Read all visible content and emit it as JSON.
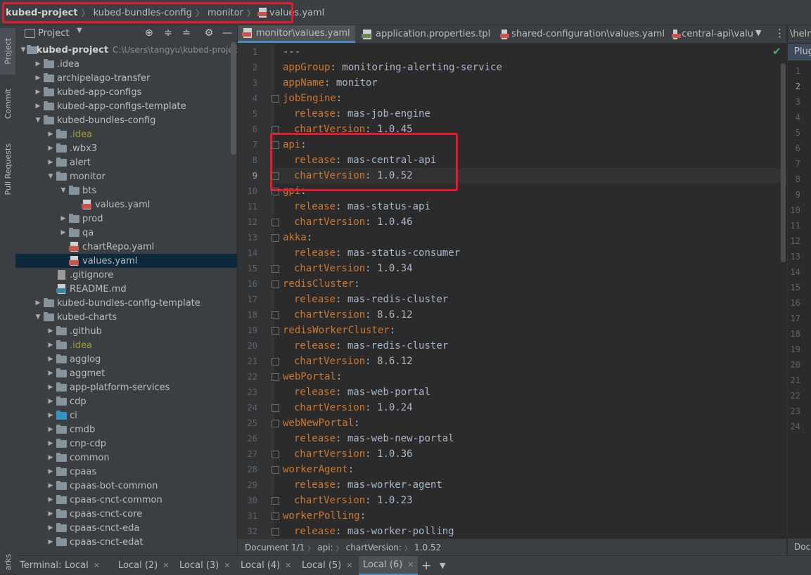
{
  "navbar": {
    "crumbs": [
      "kubed-project",
      "kubed-bundles-config",
      "monitor",
      "values.yaml"
    ]
  },
  "left_stripe": {
    "tabs": [
      "Project",
      "Commit",
      "Pull Requests"
    ],
    "bottom_tab": "arks"
  },
  "project_panel": {
    "title": "Project",
    "tree": [
      {
        "name": "kubed-project",
        "path": "C:\\Users\\tangyu\\kubed-project",
        "depth": 0,
        "type": "folder",
        "expanded": true,
        "bold": true
      },
      {
        "name": ".idea",
        "depth": 1,
        "type": "folder"
      },
      {
        "name": "archipelago-transfer",
        "depth": 1,
        "type": "folder"
      },
      {
        "name": "kubed-app-configs",
        "depth": 1,
        "type": "folder"
      },
      {
        "name": "kubed-app-configs-template",
        "depth": 1,
        "type": "folder"
      },
      {
        "name": "kubed-bundles-config",
        "depth": 1,
        "type": "folder",
        "expanded": true
      },
      {
        "name": ".idea",
        "depth": 2,
        "type": "folder",
        "ignored": true
      },
      {
        "name": ".wbx3",
        "depth": 2,
        "type": "folder"
      },
      {
        "name": "alert",
        "depth": 2,
        "type": "folder"
      },
      {
        "name": "monitor",
        "depth": 2,
        "type": "folder",
        "expanded": true
      },
      {
        "name": "bts",
        "depth": 3,
        "type": "folder",
        "expanded": true
      },
      {
        "name": "values.yaml",
        "depth": 4,
        "type": "yaml"
      },
      {
        "name": "prod",
        "depth": 3,
        "type": "folder"
      },
      {
        "name": "qa",
        "depth": 3,
        "type": "folder"
      },
      {
        "name": "chartRepo.yaml",
        "depth": 3,
        "type": "yaml",
        "leaf": true
      },
      {
        "name": "values.yaml",
        "depth": 3,
        "type": "yaml",
        "leaf": true,
        "selected": true
      },
      {
        "name": ".gitignore",
        "depth": 2,
        "type": "file",
        "leaf": true
      },
      {
        "name": "README.md",
        "depth": 2,
        "type": "md",
        "leaf": true
      },
      {
        "name": "kubed-bundles-config-template",
        "depth": 1,
        "type": "folder"
      },
      {
        "name": "kubed-charts",
        "depth": 1,
        "type": "folder",
        "expanded": true
      },
      {
        "name": ".github",
        "depth": 2,
        "type": "folder"
      },
      {
        "name": ".idea",
        "depth": 2,
        "type": "folder",
        "ignored": true
      },
      {
        "name": "agglog",
        "depth": 2,
        "type": "folder"
      },
      {
        "name": "aggmet",
        "depth": 2,
        "type": "folder"
      },
      {
        "name": "app-platform-services",
        "depth": 2,
        "type": "folder"
      },
      {
        "name": "cdp",
        "depth": 2,
        "type": "folder"
      },
      {
        "name": "ci",
        "depth": 2,
        "type": "folder",
        "blue": true
      },
      {
        "name": "cmdb",
        "depth": 2,
        "type": "folder"
      },
      {
        "name": "cnp-cdp",
        "depth": 2,
        "type": "folder"
      },
      {
        "name": "common",
        "depth": 2,
        "type": "folder"
      },
      {
        "name": "cpaas",
        "depth": 2,
        "type": "folder"
      },
      {
        "name": "cpaas-bot-common",
        "depth": 2,
        "type": "folder"
      },
      {
        "name": "cpaas-cnct-common",
        "depth": 2,
        "type": "folder"
      },
      {
        "name": "cpaas-cnct-core",
        "depth": 2,
        "type": "folder"
      },
      {
        "name": "cpaas-cnct-eda",
        "depth": 2,
        "type": "folder"
      },
      {
        "name": "cpaas-cnct-edat",
        "depth": 2,
        "type": "folder"
      }
    ]
  },
  "editor_tabs": [
    {
      "label": "monitor\\values.yaml",
      "icon": "yaml",
      "active": true
    },
    {
      "label": "application.properties.tpl",
      "icon": "doc"
    },
    {
      "label": "shared-configuration\\values.yaml",
      "icon": "yaml"
    },
    {
      "label": "central-api\\valu",
      "icon": "yaml"
    }
  ],
  "editor": {
    "current_line": 9,
    "lines": [
      {
        "n": 1,
        "indent": 0,
        "key": "---",
        "value": ""
      },
      {
        "n": 2,
        "indent": 0,
        "key": "appGroup",
        "value": "monitoring-alerting-service"
      },
      {
        "n": 3,
        "indent": 0,
        "key": "appName",
        "value": "monitor"
      },
      {
        "n": 4,
        "indent": 0,
        "key": "jobEngine",
        "value": ""
      },
      {
        "n": 5,
        "indent": 1,
        "key": "release",
        "value": "mas-job-engine"
      },
      {
        "n": 6,
        "indent": 1,
        "key": "chartVersion",
        "value": "1.0.45"
      },
      {
        "n": 7,
        "indent": 0,
        "key": "api",
        "value": ""
      },
      {
        "n": 8,
        "indent": 1,
        "key": "release",
        "value": "mas-central-api"
      },
      {
        "n": 9,
        "indent": 1,
        "key": "chartVersion",
        "value": "1.0.52"
      },
      {
        "n": 10,
        "indent": 0,
        "key": "gpi",
        "value": ""
      },
      {
        "n": 11,
        "indent": 1,
        "key": "release",
        "value": "mas-status-api"
      },
      {
        "n": 12,
        "indent": 1,
        "key": "chartVersion",
        "value": "1.0.46"
      },
      {
        "n": 13,
        "indent": 0,
        "key": "akka",
        "value": ""
      },
      {
        "n": 14,
        "indent": 1,
        "key": "release",
        "value": "mas-status-consumer"
      },
      {
        "n": 15,
        "indent": 1,
        "key": "chartVersion",
        "value": "1.0.34"
      },
      {
        "n": 16,
        "indent": 0,
        "key": "redisCluster",
        "value": ""
      },
      {
        "n": 17,
        "indent": 1,
        "key": "release",
        "value": "mas-redis-cluster"
      },
      {
        "n": 18,
        "indent": 1,
        "key": "chartVersion",
        "value": "8.6.12"
      },
      {
        "n": 19,
        "indent": 0,
        "key": "redisWorkerCluster",
        "value": ""
      },
      {
        "n": 20,
        "indent": 1,
        "key": "release",
        "value": "mas-redis-cluster"
      },
      {
        "n": 21,
        "indent": 1,
        "key": "chartVersion",
        "value": "8.6.12"
      },
      {
        "n": 22,
        "indent": 0,
        "key": "webPortal",
        "value": ""
      },
      {
        "n": 23,
        "indent": 1,
        "key": "release",
        "value": "mas-web-portal"
      },
      {
        "n": 24,
        "indent": 1,
        "key": "chartVersion",
        "value": "1.0.24"
      },
      {
        "n": 25,
        "indent": 0,
        "key": "webNewPortal",
        "value": ""
      },
      {
        "n": 26,
        "indent": 1,
        "key": "release",
        "value": "mas-web-new-portal"
      },
      {
        "n": 27,
        "indent": 1,
        "key": "chartVersion",
        "value": "1.0.36"
      },
      {
        "n": 28,
        "indent": 0,
        "key": "workerAgent",
        "value": ""
      },
      {
        "n": 29,
        "indent": 1,
        "key": "release",
        "value": "mas-worker-agent"
      },
      {
        "n": 30,
        "indent": 1,
        "key": "chartVersion",
        "value": "1.0.23"
      },
      {
        "n": 31,
        "indent": 0,
        "key": "workerPolling",
        "value": ""
      },
      {
        "n": 32,
        "indent": 1,
        "key": "release",
        "value": "mas-worker-polling"
      }
    ]
  },
  "editor_breadcrumb": [
    "Document 1/1",
    "api:",
    "chartVersion:",
    "1.0.52"
  ],
  "right_pane": {
    "tab": "\\helm",
    "header": "Plug",
    "line_numbers": [
      1,
      2,
      3,
      4,
      5,
      6,
      7,
      8,
      9,
      10,
      11,
      12,
      13,
      14,
      15,
      16,
      17,
      18,
      19,
      20,
      21,
      22,
      23,
      24
    ],
    "current_line": 2,
    "footer": "Doc"
  },
  "bottom_bar": {
    "label": "Terminal:",
    "tabs": [
      "Local",
      "Local (2)",
      "Local (3)",
      "Local (4)",
      "Local (5)",
      "Local (6)"
    ],
    "active_index": 5,
    "add_icon": "+",
    "menu_icon": "chevron-down"
  },
  "colors": {
    "highlight": "#e8192c",
    "yaml_key": "#cc7832",
    "yaml_value": "#a9b7c6",
    "selection": "#0d293e"
  }
}
